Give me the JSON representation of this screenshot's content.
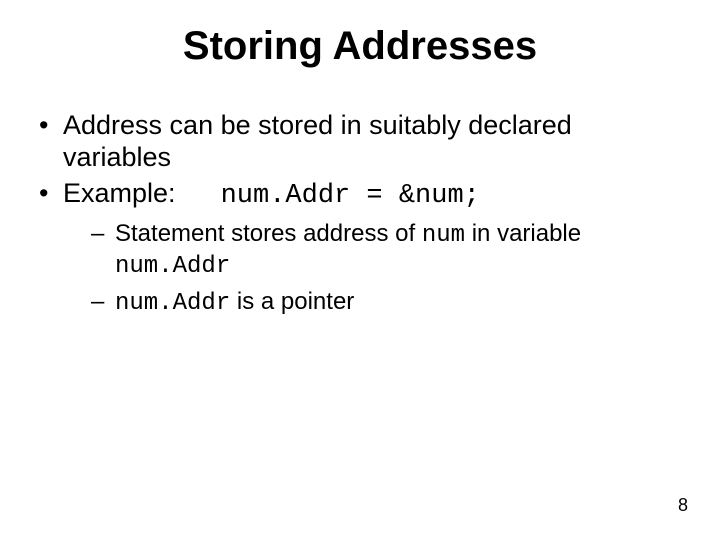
{
  "title": "Storing Addresses",
  "bullets": {
    "b1": "Address can be stored in suitably declared variables",
    "b2_label": "Example:",
    "b2_code": "num.Addr = &num;",
    "sub1_a": "Statement stores address of ",
    "sub1_code1": "num",
    "sub1_b": " in variable ",
    "sub1_code2": "num.Addr",
    "sub2_code": "num.Addr",
    "sub2_rest": " is a pointer"
  },
  "page_number": "8"
}
